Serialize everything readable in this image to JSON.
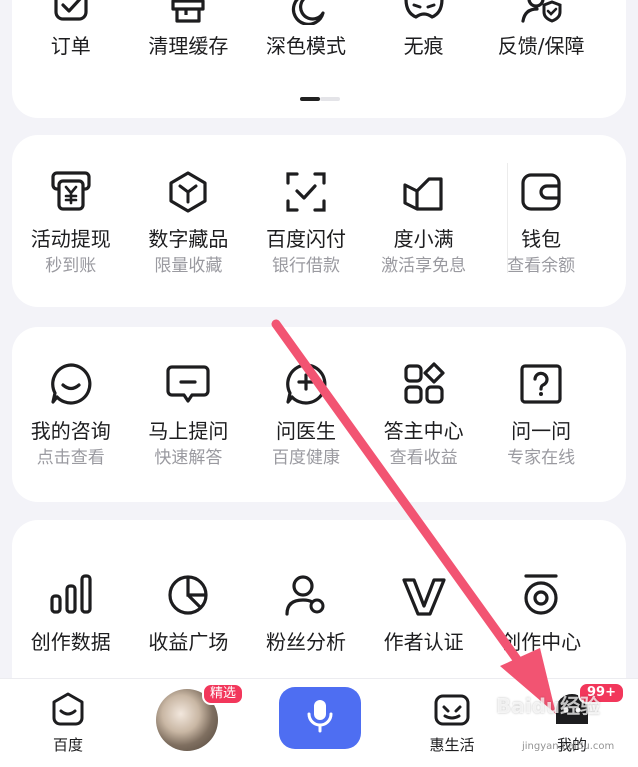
{
  "colors": {
    "accent": "#4e6ef2",
    "badge": "#f2375b",
    "arrow": "#f25472",
    "text": "#1d1d1f",
    "subtext": "#9a9aa0"
  },
  "top_row": [
    {
      "label": "订单",
      "icon": "order-check-icon"
    },
    {
      "label": "清理缓存",
      "icon": "brush-icon"
    },
    {
      "label": "深色模式",
      "icon": "moon-icon"
    },
    {
      "label": "无痕",
      "icon": "mask-icon"
    },
    {
      "label": "反馈/保障",
      "icon": "shield-user-icon"
    }
  ],
  "finance_row": [
    {
      "label": "活动提现",
      "sub": "秒到账",
      "icon": "yen-withdraw-icon"
    },
    {
      "label": "数字藏品",
      "sub": "限量收藏",
      "icon": "hexagon-icon"
    },
    {
      "label": "百度闪付",
      "sub": "银行借款",
      "icon": "scan-check-icon"
    },
    {
      "label": "度小满",
      "sub": "激活享免息",
      "icon": "duxiaoman-icon"
    },
    {
      "label": "钱包",
      "sub": "查看余额",
      "icon": "wallet-icon"
    }
  ],
  "qa_row": [
    {
      "label": "我的咨询",
      "sub": "点击查看",
      "icon": "smile-chat-icon"
    },
    {
      "label": "马上提问",
      "sub": "快速解答",
      "icon": "message-icon"
    },
    {
      "label": "问医生",
      "sub": "百度健康",
      "icon": "doctor-icon"
    },
    {
      "label": "答主中心",
      "sub": "查看收益",
      "icon": "grid-apps-icon"
    },
    {
      "label": "问一问",
      "sub": "专家在线",
      "icon": "question-icon"
    }
  ],
  "creator_row": [
    {
      "label": "创作数据",
      "icon": "bar-chart-icon"
    },
    {
      "label": "收益广场",
      "icon": "pie-chart-icon"
    },
    {
      "label": "粉丝分析",
      "icon": "fans-icon"
    },
    {
      "label": "作者认证",
      "icon": "v-badge-icon"
    },
    {
      "label": "创作中心",
      "icon": "target-icon"
    }
  ],
  "tabbar": {
    "home": "百度",
    "featured_badge": "精选",
    "life": "惠生活",
    "mine": "我的",
    "mine_badge": "99+"
  },
  "watermark": "Baidu经验",
  "watermark_sub": "jingyan.baidu.com"
}
